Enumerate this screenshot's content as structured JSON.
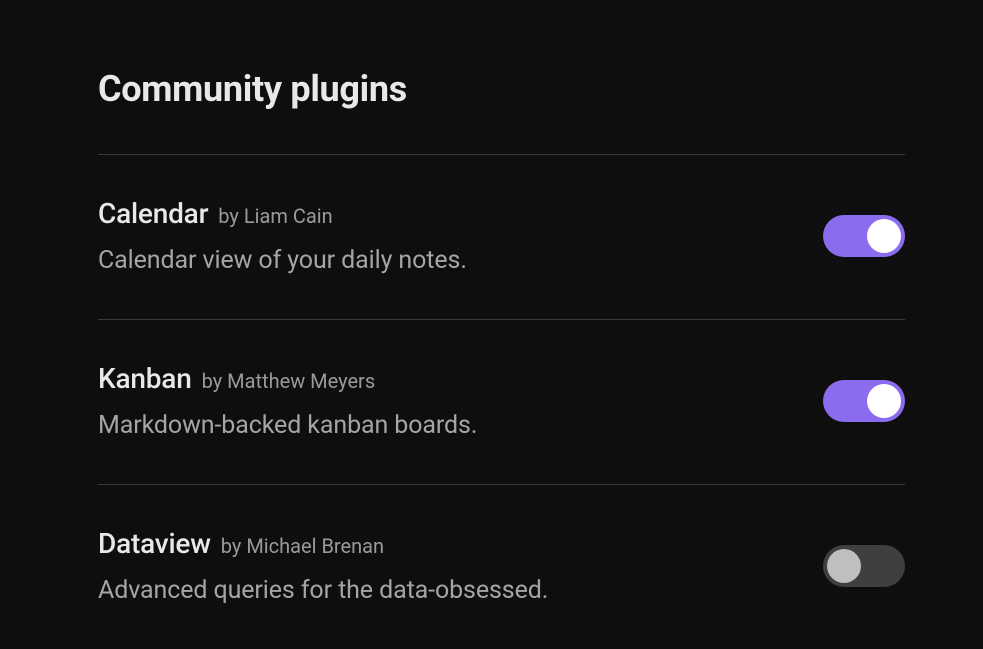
{
  "title": "Community plugins",
  "author_prefix": "by ",
  "plugins": [
    {
      "name": "Calendar",
      "author": "Liam Cain",
      "description": "Calendar view of your daily notes.",
      "enabled": true
    },
    {
      "name": "Kanban",
      "author": "Matthew Meyers",
      "description": "Markdown-backed kanban boards.",
      "enabled": true
    },
    {
      "name": "Dataview",
      "author": "Michael Brenan",
      "description": "Advanced queries for the data-obsessed.",
      "enabled": false
    }
  ]
}
